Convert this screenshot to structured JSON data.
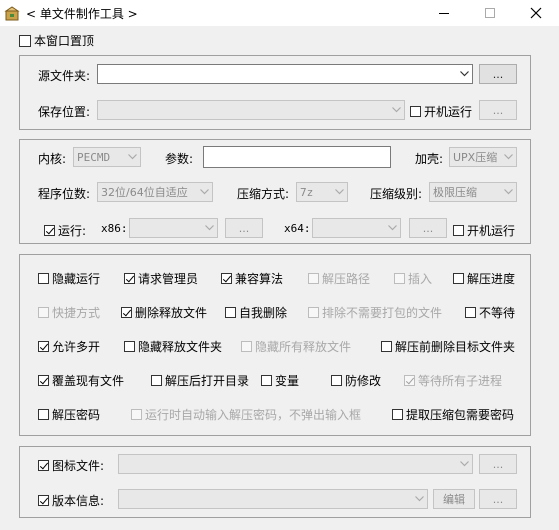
{
  "window": {
    "title": "< 单文件制作工具 >",
    "icon": "package-app-icon"
  },
  "top": {
    "stay_on_top_label": "本窗口置顶",
    "stay_on_top_checked": false
  },
  "source": {
    "source_folder_label": "源文件夹:",
    "source_folder_value": "",
    "source_browse_label": "...",
    "save_location_label": "保存位置:",
    "save_location_value": "",
    "run_at_startup_label": "开机运行",
    "save_browse_label": "..."
  },
  "options": {
    "kernel_label": "内核:",
    "kernel_value": "PECMD",
    "params_label": "参数:",
    "params_value": "",
    "shell_label": "加壳:",
    "shell_value": "UPX压缩",
    "bitness_label": "程序位数:",
    "bitness_value": "32位/64位自适应",
    "compression_method_label": "压缩方式:",
    "compression_method_value": "7z",
    "compression_level_label": "压缩级别:",
    "compression_level_value": "极限压缩",
    "run_label": "运行:",
    "x86_label": "x86:",
    "x86_value": "",
    "x86_browse": "...",
    "x64_label": "x64:",
    "x64_value": "",
    "x64_browse": "...",
    "run_at_startup_label": "开机运行"
  },
  "flags": [
    {
      "label": "隐藏运行",
      "checked": false,
      "disabled": false
    },
    {
      "label": "请求管理员",
      "checked": true,
      "disabled": false
    },
    {
      "label": "兼容算法",
      "checked": true,
      "disabled": false
    },
    {
      "label": "解压路径",
      "checked": false,
      "disabled": true
    },
    {
      "label": "插入",
      "checked": false,
      "disabled": true
    },
    {
      "label": "解压进度",
      "checked": false,
      "disabled": false
    },
    {
      "label": "快捷方式",
      "checked": false,
      "disabled": true
    },
    {
      "label": "删除释放文件",
      "checked": true,
      "disabled": false
    },
    {
      "label": "自我删除",
      "checked": false,
      "disabled": false
    },
    {
      "label": "排除不需要打包的文件",
      "checked": false,
      "disabled": true
    },
    {
      "label": "不等待",
      "checked": false,
      "disabled": false
    },
    {
      "label": "允许多开",
      "checked": true,
      "disabled": false
    },
    {
      "label": "隐藏释放文件夹",
      "checked": false,
      "disabled": false
    },
    {
      "label": "隐藏所有释放文件",
      "checked": false,
      "disabled": true
    },
    {
      "label": "解压前删除目标文件夹",
      "checked": false,
      "disabled": false
    },
    {
      "label": "覆盖现有文件",
      "checked": true,
      "disabled": false
    },
    {
      "label": "解压后打开目录",
      "checked": false,
      "disabled": false
    },
    {
      "label": "变量",
      "checked": false,
      "disabled": false
    },
    {
      "label": "防修改",
      "checked": false,
      "disabled": false
    },
    {
      "label": "等待所有子进程",
      "checked": true,
      "disabled": true
    },
    {
      "label": "解压密码",
      "checked": false,
      "disabled": false
    },
    {
      "label": "运行时自动输入解压密码，不弹出输入框",
      "checked": false,
      "disabled": true
    },
    {
      "label": "提取压缩包需要密码",
      "checked": false,
      "disabled": false
    }
  ],
  "resources": {
    "icon_file_label": "图标文件:",
    "icon_file_value": "",
    "icon_browse": "...",
    "version_info_label": "版本信息:",
    "version_info_value": "",
    "edit_label": "编辑",
    "version_browse": "..."
  }
}
